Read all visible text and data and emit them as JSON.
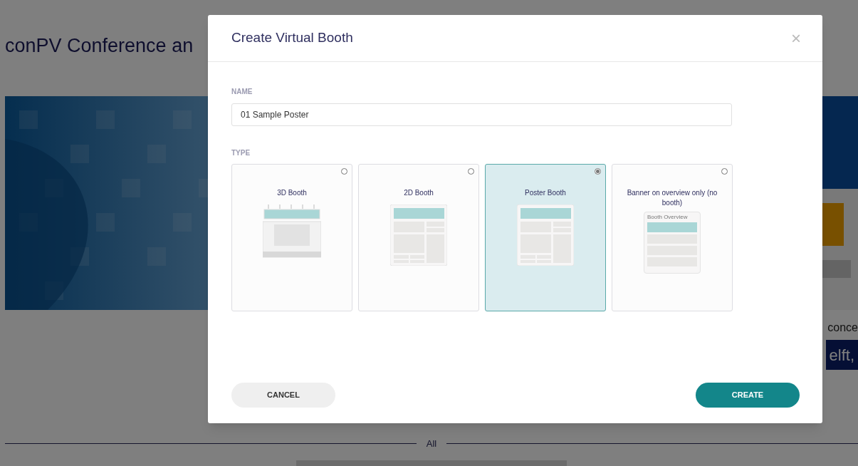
{
  "page": {
    "title": "conPV Conference an",
    "side_text": "conce",
    "band_text": "elft,",
    "divider_label": "All"
  },
  "dialog": {
    "title": "Create Virtual Booth",
    "close": "×",
    "name_field": {
      "label": "NAME",
      "value": "01 Sample Poster"
    },
    "type_label": "TYPE",
    "options": [
      {
        "label": "3D Booth",
        "kind": "threed",
        "selected": false
      },
      {
        "label": "2D Booth",
        "kind": "twod",
        "selected": false
      },
      {
        "label": "Poster Booth",
        "kind": "poster",
        "selected": true
      },
      {
        "label": "Banner on overview only (no booth)",
        "kind": "banner",
        "selected": false,
        "preview_caption": "Booth Overview"
      }
    ],
    "buttons": [
      {
        "label": "CANCEL",
        "kind": "secondary"
      },
      {
        "label": "CREATE",
        "kind": "primary"
      }
    ]
  }
}
